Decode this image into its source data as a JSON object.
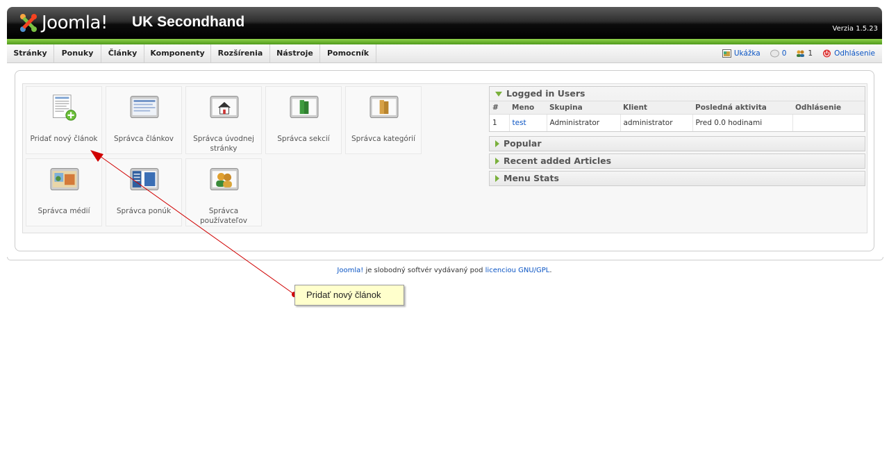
{
  "header": {
    "logo_text": "Joomla!",
    "site_title": "UK Secondhand",
    "version": "Verzia 1.5.23"
  },
  "menu": [
    "Stránky",
    "Ponuky",
    "Články",
    "Komponenty",
    "Rozšírenia",
    "Nástroje",
    "Pomocník"
  ],
  "status": {
    "preview": "Ukážka",
    "messages": "0",
    "users_online": "1",
    "logout": "Odhlásenie"
  },
  "cpanel": [
    {
      "label": "Pridať nový článok",
      "icon": "add-article-icon"
    },
    {
      "label": "Správca článkov",
      "icon": "article-manager-icon"
    },
    {
      "label": "Správca úvodnej stránky",
      "icon": "frontpage-manager-icon"
    },
    {
      "label": "Správca sekcií",
      "icon": "section-manager-icon"
    },
    {
      "label": "Správca kategórií",
      "icon": "category-manager-icon"
    },
    {
      "label": "Správca médií",
      "icon": "media-manager-icon"
    },
    {
      "label": "Správca ponúk",
      "icon": "menu-manager-icon"
    },
    {
      "label": "Správca používateľov",
      "icon": "user-manager-icon"
    }
  ],
  "modules": {
    "logged_in": {
      "title": "Logged in Users",
      "columns": [
        "#",
        "Meno",
        "Skupina",
        "Klient",
        "Posledná aktivita",
        "Odhlásenie"
      ],
      "rows": [
        [
          "1",
          "test",
          "Administrator",
          "administrator",
          "Pred 0.0 hodinami",
          ""
        ]
      ]
    },
    "popular": "Popular",
    "recent": "Recent added Articles",
    "menu_stats": "Menu Stats"
  },
  "footer": {
    "joomla": "Joomla!",
    "middle": " je slobodný softvér vydávaný pod ",
    "license": "licenciou GNU/GPL",
    "end": "."
  },
  "annotation": "Pridať nový článok",
  "colors": {
    "green_accent": "#7ab03c",
    "link": "#0b55c4",
    "callout_bg": "#ffffcc",
    "arrow": "#d00000"
  }
}
